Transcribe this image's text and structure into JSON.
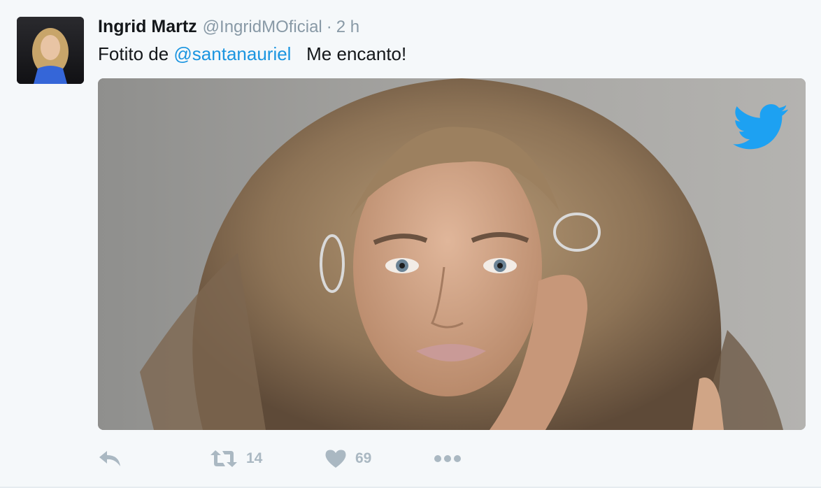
{
  "tweet": {
    "author": {
      "name": "Ingrid Martz",
      "handle": "@IngridMOficial",
      "separator": "·",
      "time": "2 h"
    },
    "text": {
      "before": "Fotito de ",
      "mention": "@santanauriel",
      "after": "   Me encanto!"
    },
    "media": {
      "overlay_icon": "twitter-bird-icon"
    },
    "actions": {
      "reply": {
        "icon": "reply-icon"
      },
      "retweet": {
        "icon": "retweet-icon",
        "count": "14"
      },
      "like": {
        "icon": "heart-icon",
        "count": "69"
      },
      "more": {
        "icon": "more-dots-icon"
      }
    }
  },
  "colors": {
    "background": "#f5f8fa",
    "name": "#14171a",
    "meta": "#8899a6",
    "link": "#1b95e0",
    "action_icons": "#aab8c2",
    "twitter_bird": "#1da1f2"
  }
}
